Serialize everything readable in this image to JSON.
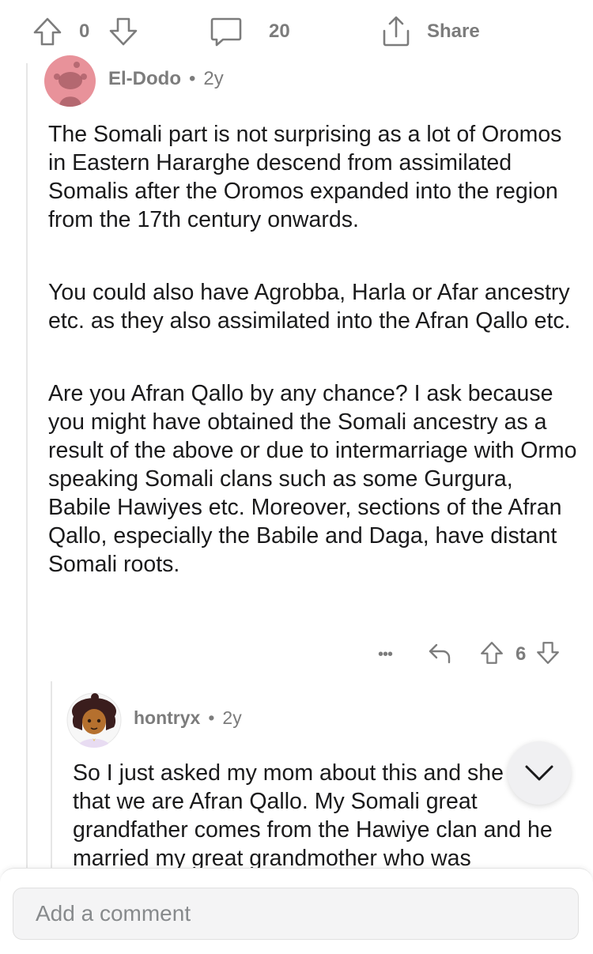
{
  "post_bar": {
    "upvote_count": "0",
    "comment_count": "20",
    "share_label": "Share"
  },
  "comment": {
    "author": "El-Dodo",
    "separator": "•",
    "age": "2y",
    "paragraphs": [
      "The Somali part is not surprising as a lot of Oromos in Eastern Hararghe descend from assimilated Somalis after the Oromos expanded into the region from the 17th century onwards.",
      "You could also have Agrobba, Harla or Afar ancestry etc. as they also assimilated into the Afran Qallo etc.",
      "Are you Afran Qallo by any chance?  I ask because you might have obtained the Somali ancestry as a result of the above or due to intermarriage with Ormo speaking Somali clans such as some Gurgura, Babile Hawiyes etc. Moreover, sections of the Afran Qallo, especially the Babile and Daga, have distant Somali roots."
    ],
    "vote_count": "6",
    "more_label": "•••"
  },
  "reply": {
    "author": "hontryx",
    "separator": "•",
    "age": "2y",
    "text": "So I just asked my mom about this and she said that we are Afran Qallo. My Somali great grandfather comes from the Hawiye clan and he married my great grandmother who was"
  },
  "composer": {
    "placeholder": "Add a comment"
  },
  "colors": {
    "muted": "#7c7c7c",
    "text": "#1a1a1b",
    "avatar_pink": "#e8929a"
  }
}
